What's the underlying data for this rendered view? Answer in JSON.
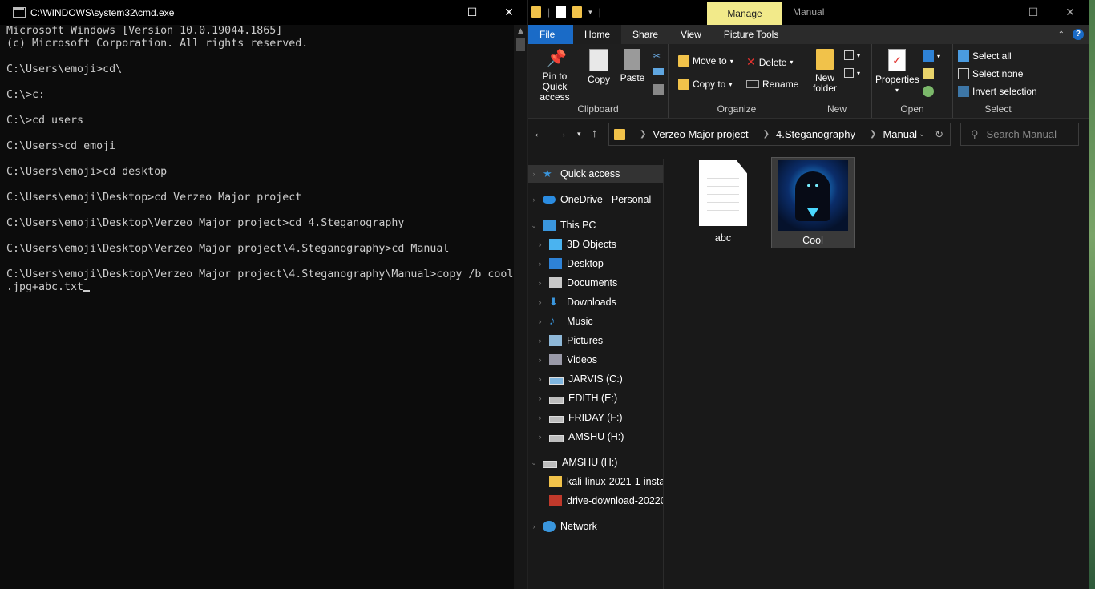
{
  "cmd": {
    "title": "C:\\WINDOWS\\system32\\cmd.exe",
    "lines": [
      "Microsoft Windows [Version 10.0.19044.1865]",
      "(c) Microsoft Corporation. All rights reserved.",
      "",
      "C:\\Users\\emoji>cd\\",
      "",
      "C:\\>c:",
      "",
      "C:\\>cd users",
      "",
      "C:\\Users>cd emoji",
      "",
      "C:\\Users\\emoji>cd desktop",
      "",
      "C:\\Users\\emoji\\Desktop>cd Verzeo Major project",
      "",
      "C:\\Users\\emoji\\Desktop\\Verzeo Major project>cd 4.Steganography",
      "",
      "C:\\Users\\emoji\\Desktop\\Verzeo Major project\\4.Steganography>cd Manual",
      "",
      "C:\\Users\\emoji\\Desktop\\Verzeo Major project\\4.Steganography\\Manual>copy /b cool",
      ".jpg+abc.txt"
    ]
  },
  "explorer": {
    "window_title": "Manual",
    "context_tab": "Manage",
    "tabs": [
      "File",
      "Home",
      "Share",
      "View",
      "Picture Tools"
    ],
    "ribbon": {
      "clipboard": {
        "label": "Clipboard",
        "pin": "Pin to Quick access",
        "copy": "Copy",
        "paste": "Paste"
      },
      "organize": {
        "label": "Organize",
        "move_to": "Move to",
        "copy_to": "Copy to",
        "delete": "Delete",
        "rename": "Rename"
      },
      "new": {
        "label": "New",
        "new_folder": "New folder"
      },
      "open": {
        "label": "Open",
        "properties": "Properties"
      },
      "select": {
        "label": "Select",
        "select_all": "Select all",
        "select_none": "Select none",
        "invert": "Invert selection"
      }
    },
    "breadcrumb": [
      "Verzeo Major project",
      "4.Steganography",
      "Manual"
    ],
    "search_placeholder": "Search Manual",
    "nav": [
      {
        "label": "Quick access",
        "icon": "star-icon",
        "color": "#3a96dd"
      },
      {
        "label": "OneDrive - Personal",
        "icon": "cloud-icon",
        "color": "#2b8ce0"
      },
      {
        "label": "This PC",
        "icon": "pc-icon",
        "color": "#3a96dd"
      },
      {
        "label": "3D Objects",
        "icon": "cube-icon",
        "color": "#4ab3f0"
      },
      {
        "label": "Desktop",
        "icon": "desktop-icon",
        "color": "#2e82d6"
      },
      {
        "label": "Documents",
        "icon": "documents-icon",
        "color": "#c9c9c9"
      },
      {
        "label": "Downloads",
        "icon": "download-icon",
        "color": "#3a96dd"
      },
      {
        "label": "Music",
        "icon": "music-icon",
        "color": "#3a96dd"
      },
      {
        "label": "Pictures",
        "icon": "pictures-icon",
        "color": "#8fb8d8"
      },
      {
        "label": "Videos",
        "icon": "videos-icon",
        "color": "#9a9aa8"
      },
      {
        "label": "JARVIS (C:)",
        "icon": "drive-os-icon",
        "color": "#7fb6e0"
      },
      {
        "label": "EDITH (E:)",
        "icon": "drive-icon",
        "color": "#bdbdbd"
      },
      {
        "label": "FRIDAY (F:)",
        "icon": "drive-icon",
        "color": "#bdbdbd"
      },
      {
        "label": "AMSHU (H:)",
        "icon": "drive-icon",
        "color": "#bdbdbd"
      },
      {
        "label": "AMSHU (H:)",
        "icon": "drive-icon",
        "color": "#bdbdbd"
      },
      {
        "label": "kali-linux-2021-1-insta",
        "icon": "folder-icon",
        "color": "#f1c24a"
      },
      {
        "label": "drive-download-20220",
        "icon": "archive-icon",
        "color": "#c0392b"
      },
      {
        "label": "Network",
        "icon": "network-icon",
        "color": "#3a96dd"
      }
    ],
    "files": [
      {
        "name": "abc",
        "type": "text-file-icon"
      },
      {
        "name": "Cool",
        "type": "image-thumbnail"
      }
    ]
  }
}
